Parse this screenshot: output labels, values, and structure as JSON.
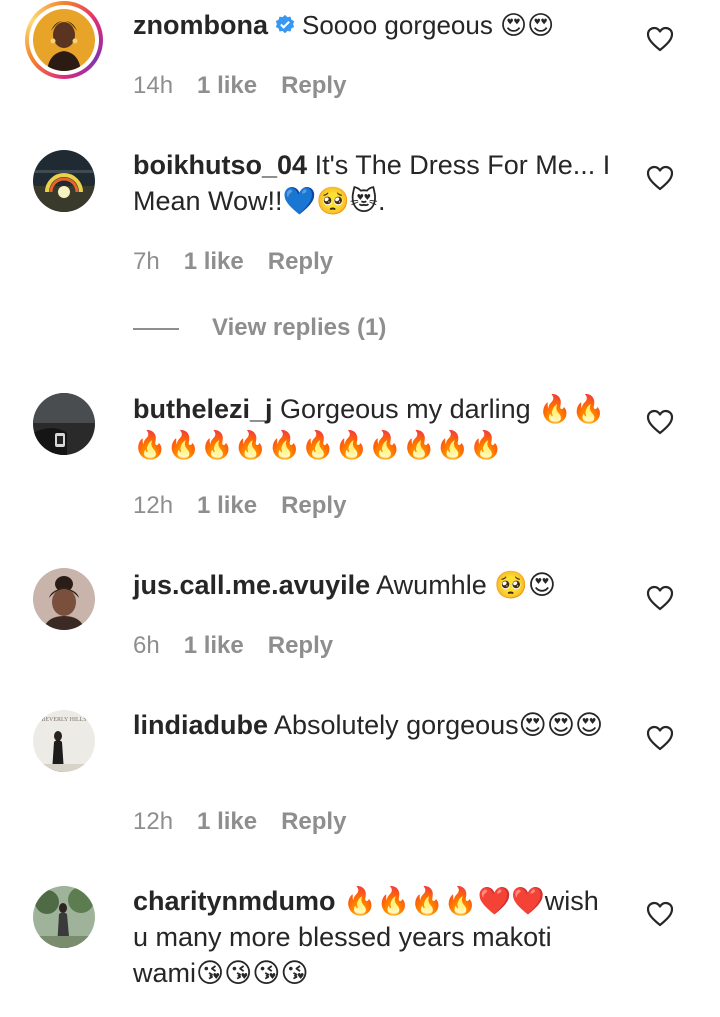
{
  "comments": [
    {
      "username": "znombona",
      "verified": true,
      "text": "Soooo gorgeous 😍😍",
      "time": "14h",
      "likes": "1 like",
      "reply": "Reply"
    },
    {
      "username": "boikhutso_04",
      "text": "It's The Dress For Me... I Mean Wow!!💙🥺😻.",
      "time": "7h",
      "likes": "1 like",
      "reply": "Reply",
      "view_replies": "View replies (1)"
    },
    {
      "username": "buthelezi_j",
      "text": "Gorgeous my darling 🔥🔥🔥🔥🔥🔥🔥🔥🔥🔥🔥🔥🔥",
      "time": "12h",
      "likes": "1 like",
      "reply": "Reply"
    },
    {
      "username": "jus.call.me.avuyile",
      "text": "Awumhle 🥺😍",
      "time": "6h",
      "likes": "1 like",
      "reply": "Reply"
    },
    {
      "username": "lindiadube",
      "text": "Absolutely gorgeous😍😍😍",
      "time": "12h",
      "likes": "1 like",
      "reply": "Reply",
      "avatar_sign": "BEVERLY HILLS"
    },
    {
      "username": "charitynmdumo",
      "text": "🔥🔥🔥🔥❤️❤️wish u many more blessed years makoti wami😘😘😘😘"
    }
  ],
  "icons": {
    "like": "heart-outline-icon",
    "verified": "verified-badge-icon"
  },
  "colors": {
    "text": "#262626",
    "secondary": "#8e8e8e",
    "verified": "#3897f0"
  }
}
